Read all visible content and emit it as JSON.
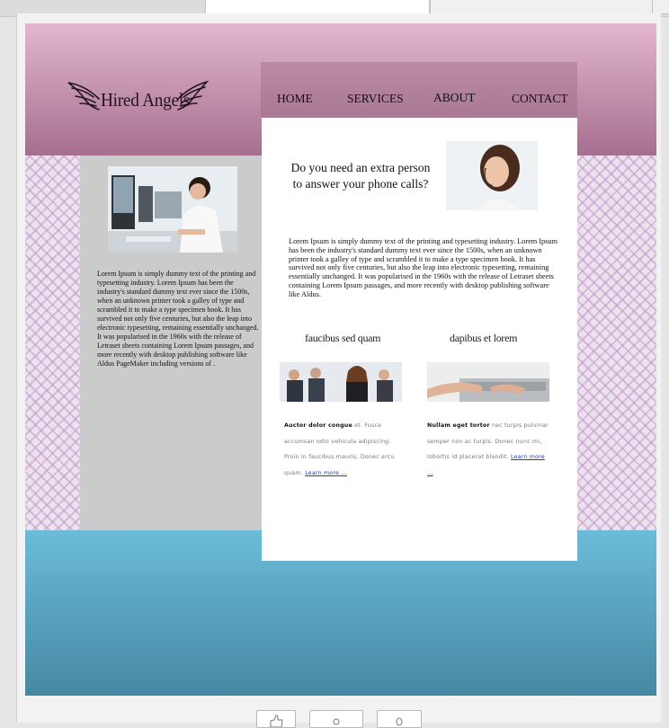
{
  "brand": {
    "name": "Hired Angels"
  },
  "nav": [
    {
      "label": "HOME"
    },
    {
      "label": "SERVICES"
    },
    {
      "label": "ABOUT"
    },
    {
      "label": "CONTACT"
    }
  ],
  "sidebar": {
    "text": "Lorem Ipsum is simply dummy text of the printing and typesetting industry. Lorem Ipsum has been the industry's standard dummy text ever since the 1500s, when an unknown printer took a galley of type and scrambled it to make a type specimen book. It has survived not only five centuries, but also the leap into electronic typesetting, remaining essentially unchanged. It was popularised in the 1960s with the release of Letraset sheets containing Lorem Ipsum passages, and more recently with desktop publishing software like Aldus PageMaker including versions of ."
  },
  "main": {
    "question_line1": "Do you need an extra person",
    "question_line2": "to answer your phone calls?",
    "intro": "Lorem Ipsum is simply dummy text of the printing and typesetting industry. Lorem Ipsum has been the industry's standard dummy text ever since the 1500s, when an unknown printer took a galley of type and scrambled it to make a type specimen book. It has survived not only five centuries, but also the leap into electronic typesetting, remaining essentially unchanged. It was popularised in the 1960s with the release of Letraset sheets containing Lorem Ipsum passages, and more recently with desktop publishing software like Aldus.",
    "cards": [
      {
        "heading": "faucibus sed quam",
        "bold": "Auctor dolor congue",
        "text": " et. Fusce accumsan odio vehicula adipiscing. Proin in faucibus mauris. Donec arcu quam. ",
        "link": "Learn more ..."
      },
      {
        "heading": "dapibus et lorem",
        "bold": "Nullam eget tortor",
        "text": " nec turpis pulvinar semper non ac turpis. Donec nunc mi, lobortis id placerat blandit. ",
        "link": "Learn more ..."
      }
    ]
  },
  "colors": {
    "header_top": "#e3b7cd",
    "header_bottom": "#a56f8f",
    "footer_top": "#6bbcd9",
    "footer_bottom": "#4688a3",
    "link": "#1a3fa8"
  }
}
